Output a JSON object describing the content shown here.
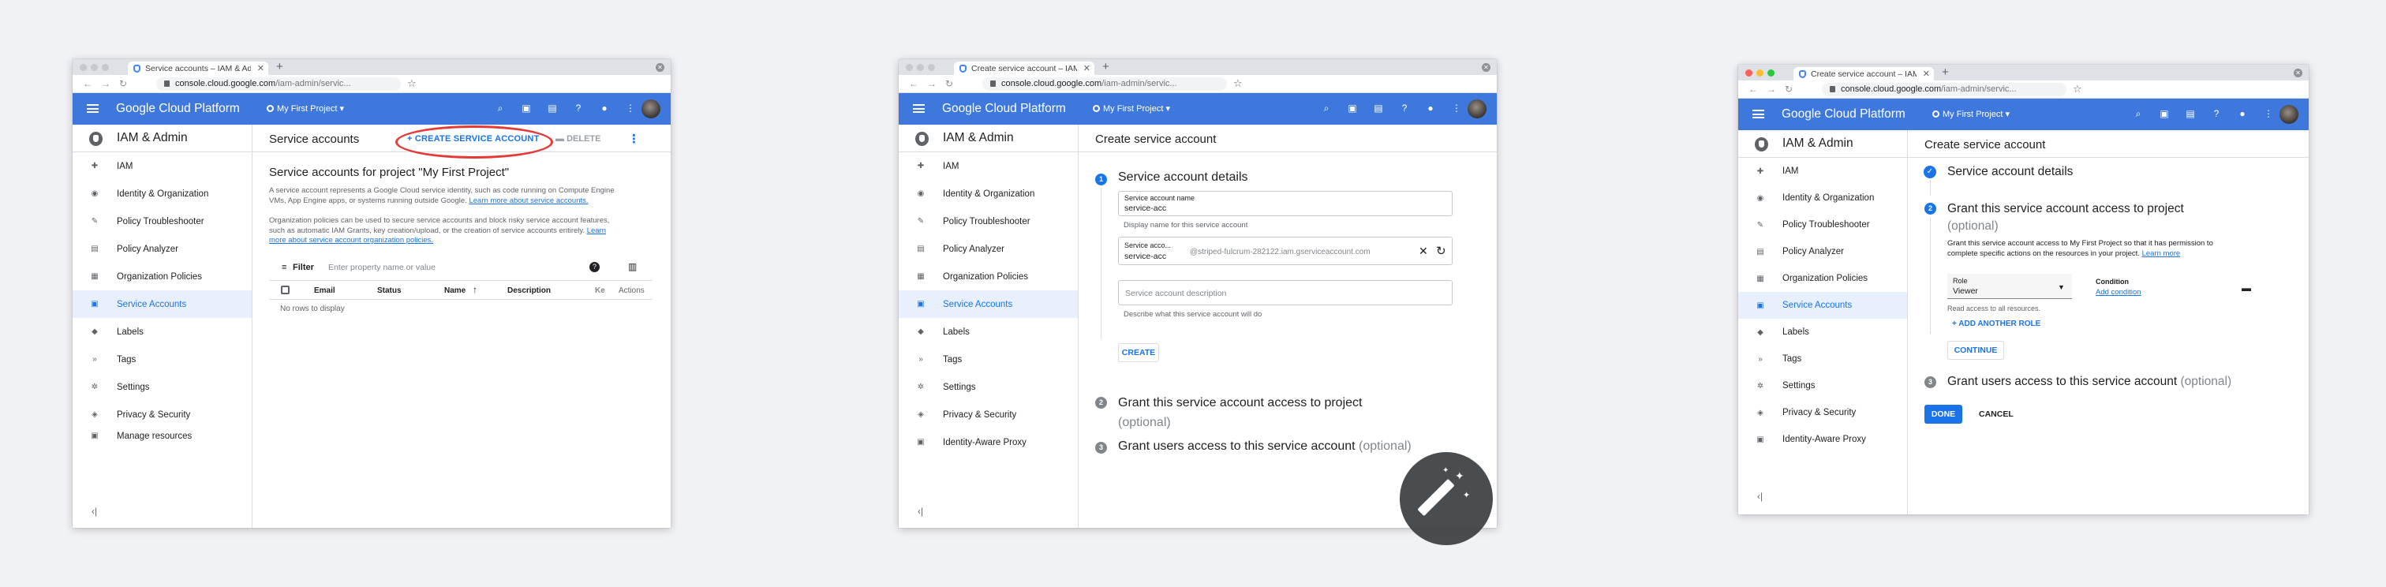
{
  "browser": {
    "tab1_title": "Service accounts – IAM & Admin",
    "tab2_title": "Create service account – IAM & Admin",
    "tab3_title": "Create service account – IAM & Admin",
    "url_host": "console.cloud.google.com",
    "url_path": "/iam-admin/servic..."
  },
  "gcp": {
    "title": "Google Cloud Platform",
    "project": "My First Project"
  },
  "sidebar": {
    "title": "IAM & Admin",
    "items_w1": [
      "IAM",
      "Identity & Organization",
      "Policy Troubleshooter",
      "Policy Analyzer",
      "Organization Policies",
      "Service Accounts",
      "Labels",
      "Tags",
      "Settings",
      "Privacy & Security",
      "Manage resources"
    ],
    "items_w2": [
      "IAM",
      "Identity & Organization",
      "Policy Troubleshooter",
      "Policy Analyzer",
      "Organization Policies",
      "Service Accounts",
      "Labels",
      "Tags",
      "Settings",
      "Privacy & Security",
      "Identity-Aware Proxy"
    ],
    "collapse": "‹|"
  },
  "w1": {
    "page_title": "Service accounts",
    "create_button": "CREATE SERVICE ACCOUNT",
    "delete_button": "DELETE",
    "heading": "Service accounts for project \"My First Project\"",
    "desc1_line1": "A service account represents a Google Cloud service identity, such as code running on Compute Engine",
    "desc1_line2": "VMs, App Engine apps, or systems running outside Google.",
    "desc1_link": "Learn more about service accounts.",
    "desc2_line1": "Organization policies can be used to secure service accounts and block risky service account features,",
    "desc2_line2": "such as automatic IAM Grants, key creation/upload, or the creation of service accounts entirely.",
    "desc2_link_a": "Learn",
    "desc2_link_b": "more about service account organization policies.",
    "filter_label": "Filter",
    "filter_placeholder": "Enter property name or value",
    "columns": [
      "Email",
      "Status",
      "Name",
      "Description",
      "Ke",
      "Actions"
    ],
    "empty": "No rows to display"
  },
  "w2": {
    "page_title": "Create service account",
    "step1_title": "Service account details",
    "name_label": "Service account name",
    "name_value": "service-acc",
    "name_hint": "Display name for this service account",
    "id_label": "Service acco...",
    "id_value": "service-acc",
    "id_suffix": "@striped-fulcrum-282122.iam.gserviceaccount.com",
    "desc_placeholder": "Service account description",
    "desc_hint": "Describe what this service account will do",
    "create_button": "CREATE",
    "step2_title": "Grant this service account access to project",
    "step2_optional": "(optional)",
    "step3_title": "Grant users access to this service account",
    "step3_optional": "(optional)"
  },
  "w3": {
    "page_title": "Create service account",
    "step1_title": "Service account details",
    "step2_title": "Grant this service account access to project",
    "step2_optional": "(optional)",
    "step2_desc_line1": "Grant this service account access to My First Project so that it has permission to",
    "step2_desc_line2": "complete specific actions on the resources in your project.",
    "step2_link": "Learn more",
    "role_label": "Role",
    "role_value": "Viewer",
    "condition_label": "Condition",
    "add_condition": "Add condition",
    "role_hint": "Read access to all resources.",
    "add_role": "ADD ANOTHER ROLE",
    "continue": "CONTINUE",
    "step3_title": "Grant users access to this service account",
    "step3_optional": "(optional)",
    "done": "DONE",
    "cancel": "CANCEL"
  },
  "steps": {
    "one": "1",
    "two": "2",
    "three": "3"
  },
  "colors": {
    "gcp_blue": "#3f78dc",
    "link_blue": "#1a73e8",
    "highlight_red": "#e53935"
  }
}
